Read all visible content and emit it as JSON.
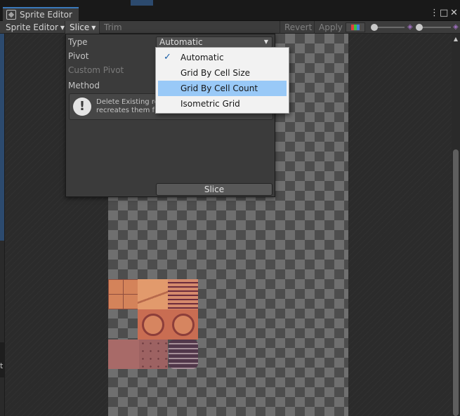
{
  "window": {
    "tab_title": "Sprite Editor",
    "controls": [
      "⋮",
      "□",
      "✕"
    ]
  },
  "toolbar": {
    "editor_dropdown": "Sprite Editor",
    "slice_dropdown": "Slice",
    "trim_label": "Trim",
    "revert_label": "Revert",
    "apply_label": "Apply",
    "icons": [
      "rgb-channels-icon",
      "zoom-slider",
      "mip-level-slider"
    ]
  },
  "slice_panel": {
    "type_label": "Type",
    "type_value": "Automatic",
    "pivot_label": "Pivot",
    "custom_pivot_label": "Custom Pivot",
    "method_label": "Method",
    "help_line1": "Delete Existing rem",
    "help_line2": "recreates them fro",
    "slice_button": "Slice"
  },
  "type_menu": {
    "items": [
      {
        "label": "Automatic",
        "checked": true
      },
      {
        "label": "Grid By Cell Size",
        "checked": false
      },
      {
        "label": "Grid By Cell Count",
        "checked": false,
        "hovered": true
      },
      {
        "label": "Isometric Grid",
        "checked": false
      }
    ]
  },
  "left_edge": {
    "glyph": "t"
  },
  "colors": {
    "accent": "#3a79bb",
    "menu_highlight": "#99c9f7",
    "panel_bg": "#3b3b3b"
  }
}
